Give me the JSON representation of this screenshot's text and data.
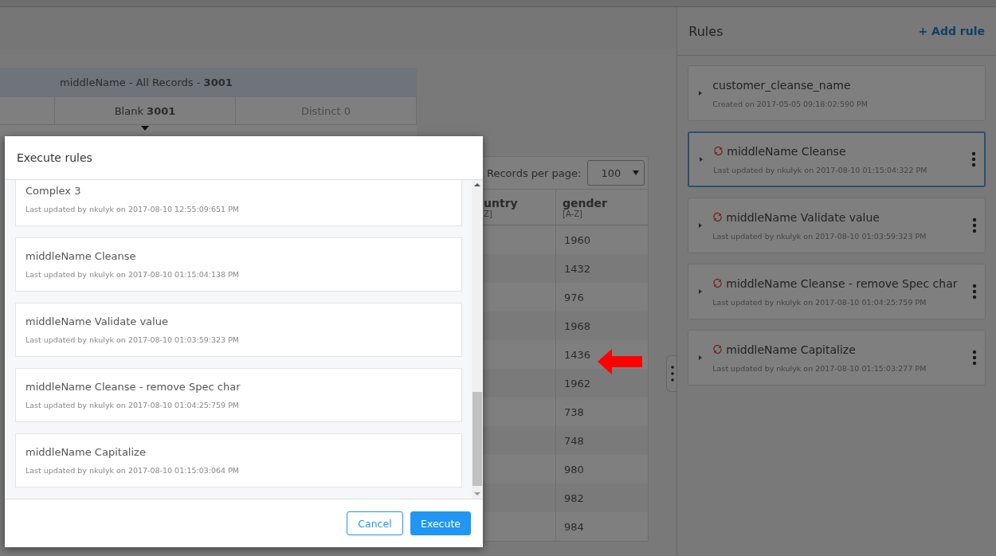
{
  "stats_table": {
    "title": "middleName - All Records - **3001**",
    "tabs": [
      {
        "label": "Blank **3001**",
        "selected": true
      },
      {
        "label": "Distinct 0",
        "selected": false
      }
    ]
  },
  "data_table": {
    "records_per_page_label": "Records per page:",
    "records_per_page": "100",
    "columns": [
      {
        "label": "untry",
        "sub": "Z]"
      },
      {
        "label": "gender",
        "sub": "[A-Z]"
      }
    ],
    "rows": [
      [
        "",
        "1960"
      ],
      [
        "",
        "1432"
      ],
      [
        "",
        "976"
      ],
      [
        "",
        "1968"
      ],
      [
        "",
        "1436"
      ],
      [
        "",
        "1962"
      ],
      [
        "",
        "738"
      ],
      [
        "",
        "748"
      ],
      [
        "",
        "980"
      ],
      [
        "",
        "982"
      ],
      [
        "",
        "984"
      ]
    ]
  },
  "rules_panel": {
    "title": "Rules",
    "add_label": "+ Add rule",
    "rules": [
      {
        "name": "customer_cleanse_name",
        "meta": "Created on 2017-05-05 09:18:02:590 PM",
        "kind": "plain",
        "selected": false
      },
      {
        "name": "middleName Cleanse",
        "meta": "Last updated by nkulyk on 2017-08-10 01:15:04:322 PM",
        "kind": "sync",
        "selected": true
      },
      {
        "name": "middleName Validate value",
        "meta": "Last updated by nkulyk on 2017-08-10 01:03:59:323 PM",
        "kind": "sync",
        "selected": false
      },
      {
        "name": "middleName Cleanse - remove Spec char",
        "meta": "Last updated by nkulyk on 2017-08-10 01:04:25:759 PM",
        "kind": "sync",
        "selected": false
      },
      {
        "name": "middleName Capitalize",
        "meta": "Last updated by nkulyk on 2017-08-10 01:15:03:277 PM",
        "kind": "sync",
        "selected": false
      }
    ]
  },
  "dialog": {
    "title": "Execute rules",
    "rules": [
      {
        "name": "Complex 3",
        "meta": "Last updated by nkulyk on 2017-08-10 12:55:09:651 PM"
      },
      {
        "name": "middleName Cleanse",
        "meta": "Last updated by nkulyk on 2017-08-10 01:15:04:138 PM"
      },
      {
        "name": "middleName Validate value",
        "meta": "Last updated by nkulyk on 2017-08-10 01:03:59:323 PM"
      },
      {
        "name": "middleName Cleanse - remove Spec char",
        "meta": "Last updated by nkulyk on 2017-08-10 01:04:25:759 PM"
      },
      {
        "name": "middleName Capitalize",
        "meta": "Last updated by nkulyk on 2017-08-10 01:15:03:064 PM"
      }
    ],
    "buttons": [
      {
        "label": "Cancel",
        "kind": "secondary"
      },
      {
        "label": "Execute",
        "kind": "primary"
      }
    ]
  }
}
